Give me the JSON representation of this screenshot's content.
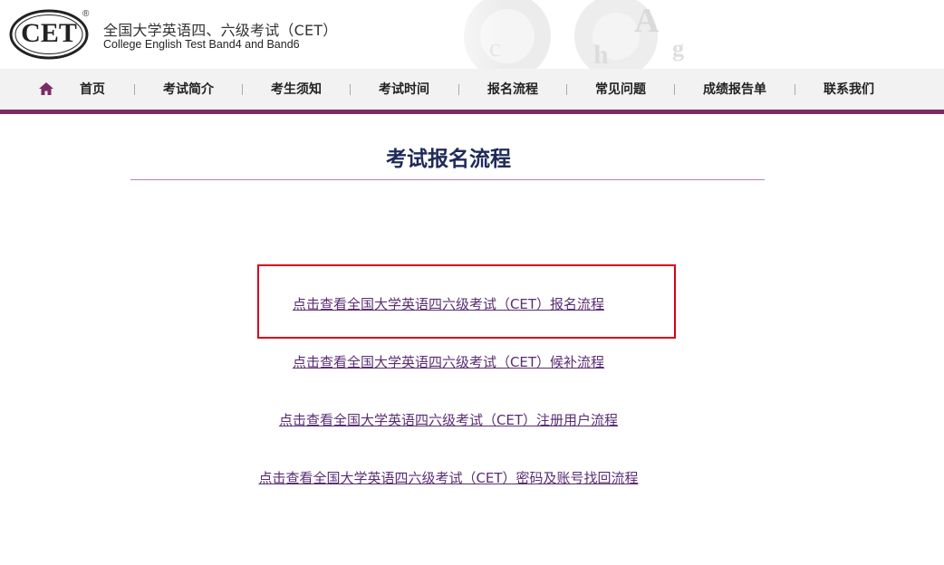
{
  "header": {
    "logo_text": "CET",
    "registered_mark": "®",
    "title_cn": "全国大学英语四、六级考试（CET）",
    "title_en": "College English Test Band4 and Band6"
  },
  "nav": {
    "home_icon": "home-icon",
    "items": [
      {
        "label": "首页"
      },
      {
        "label": "考试简介"
      },
      {
        "label": "考生须知"
      },
      {
        "label": "考试时间"
      },
      {
        "label": "报名流程"
      },
      {
        "label": "常见问题"
      },
      {
        "label": "成绩报告单"
      },
      {
        "label": "联系我们"
      }
    ]
  },
  "main": {
    "title": "考试报名流程",
    "links": [
      {
        "label": "点击查看全国大学英语四六级考试（CET）报名流程",
        "highlighted": true
      },
      {
        "label": "点击查看全国大学英语四六级考试（CET）候补流程"
      },
      {
        "label": "点击查看全国大学英语四六级考试（CET）注册用户流程"
      },
      {
        "label": "点击查看全国大学英语四六级考试（CET）密码及账号找回流程"
      }
    ]
  },
  "colors": {
    "brand_purple": "#7a2c67",
    "link": "#5a2d73",
    "title": "#1e2a5a",
    "highlight": "#d9001b"
  }
}
